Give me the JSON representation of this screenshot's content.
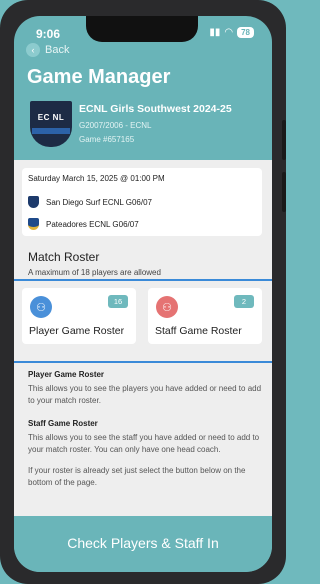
{
  "status": {
    "time": "9:06",
    "battery": "78"
  },
  "nav": {
    "back_label": "Back"
  },
  "page": {
    "title": "Game Manager"
  },
  "event": {
    "title": "ECNL Girls Southwest 2024-25",
    "division": "G2007/2006 - ECNL",
    "game": "Game #657165",
    "logo_text": "EC NL",
    "logo_banner": "SOUTHWEST"
  },
  "match": {
    "datetime": "Saturday March 15, 2025 @ 01:00 PM",
    "home_team": "San Diego Surf ECNL G06/07",
    "away_team": "Pateadores ECNL G06/07"
  },
  "roster": {
    "title": "Match Roster",
    "subtitle": "A maximum of 18 players are allowed",
    "player_tile": {
      "label": "Player Game Roster",
      "count": "16",
      "icon": "player-icon",
      "color": "#4a90d9"
    },
    "staff_tile": {
      "label": "Staff Game Roster",
      "count": "2",
      "icon": "staff-icon",
      "color": "#e57373"
    }
  },
  "info": {
    "player_heading": "Player Game Roster",
    "player_text": "This allows you to see the players you have added or need to add to your match roster.",
    "staff_heading": "Staff Game Roster",
    "staff_text": "This allows you to see the staff you have added or need to add to your match roster. You can only have one head coach.",
    "note_text": "If your roster is already set just select the button below on the bottom of the page."
  },
  "cta": {
    "label": "Check Players & Staff In"
  },
  "colors": {
    "teal": "#6fb9bd",
    "content_bg": "#eeeeee",
    "accent_line": "#3a8ad8"
  }
}
